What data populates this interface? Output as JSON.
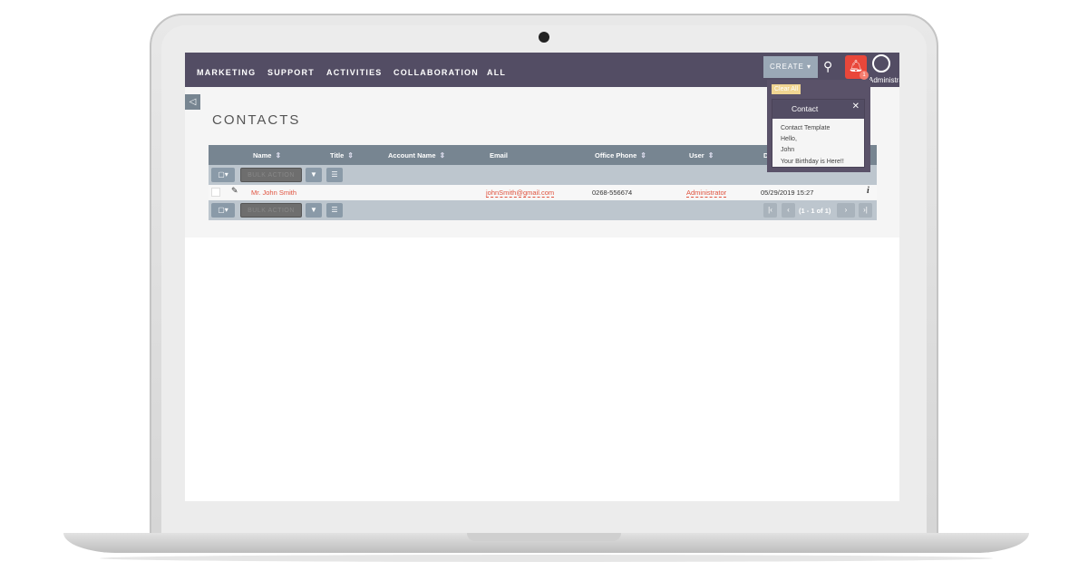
{
  "nav": {
    "items": [
      "MARKETING",
      "SUPPORT",
      "ACTIVITIES",
      "COLLABORATION",
      "ALL"
    ],
    "create_label": "CREATE",
    "user_label": "Administrator",
    "notification_count": "1"
  },
  "page": {
    "title": "CONTACTS"
  },
  "table": {
    "columns": [
      "Name",
      "Title",
      "Account Name",
      "Email",
      "Office Phone",
      "User",
      "D"
    ],
    "bulk_action": "BULK ACTION",
    "rows": [
      {
        "name": "Mr. John Smith",
        "title": "",
        "account": "",
        "email": "johnSmith@gmail.com",
        "phone": "0268-556674",
        "user": "Administrator",
        "date": "05/29/2019 15:27"
      }
    ],
    "pagination": "(1 - 1 of 1)"
  },
  "notification": {
    "clear_all": "Clear All",
    "title": "Contact",
    "lines": [
      "Contact Template",
      "Hello,",
      "John",
      "Your Birthday is Here!!"
    ]
  },
  "colors": {
    "nav": "#534d64",
    "link": "#e0533f",
    "bell": "#e9473a"
  }
}
